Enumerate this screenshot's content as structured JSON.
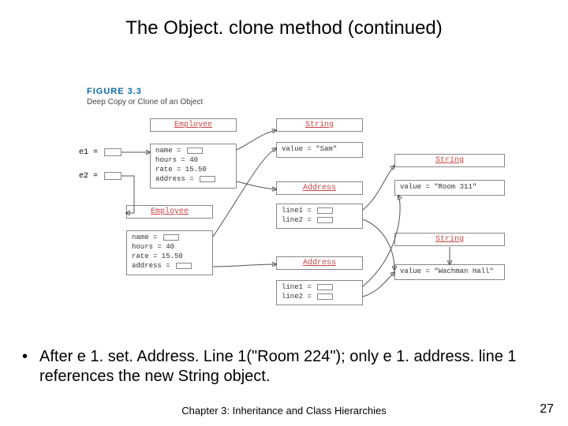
{
  "title": "The Object. clone method (continued)",
  "figure": {
    "label": "FIGURE 3.3",
    "caption": "Deep Copy or Clone of an Object"
  },
  "vars": {
    "e1": "e1 =",
    "e2": "e2 ="
  },
  "employee": {
    "head": "Employee",
    "body": "name =\nhours = 40\nrate = 15.50\naddress ="
  },
  "string_sam": {
    "head": "String",
    "body": "value = \"Sam\""
  },
  "string_room311": {
    "head": "String",
    "body": "value = \"Room 311\""
  },
  "string_wachman": {
    "head": "String",
    "body": "value = \"Wachman Hall\""
  },
  "string_generic": {
    "head": "String"
  },
  "address": {
    "head": "Address",
    "body": "line1 =\nline2 ="
  },
  "bullet": "After e 1. set. Address. Line 1(\"Room 224\"); only e 1. address. line 1 references the new String object.",
  "footer": "Chapter 3: Inheritance and Class Hierarchies",
  "page": "27"
}
